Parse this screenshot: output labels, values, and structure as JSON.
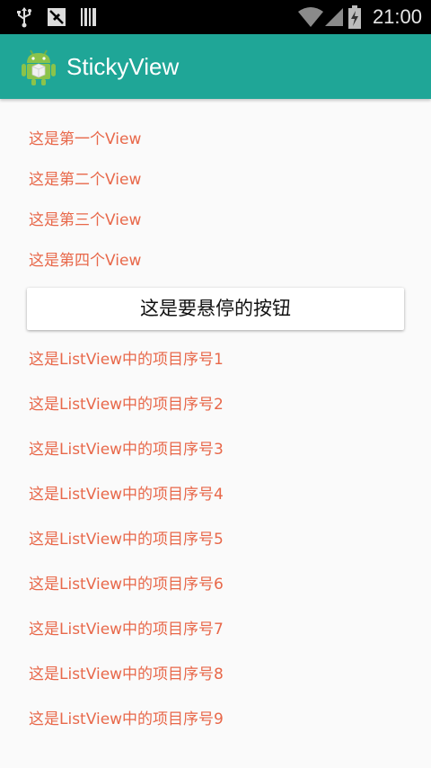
{
  "status_bar": {
    "time": "21:00",
    "icons": [
      "usb-icon",
      "no-sim-icon",
      "barcode-icon",
      "wifi-icon",
      "signal-icon",
      "battery-charging-icon"
    ]
  },
  "app_bar": {
    "title": "StickyView",
    "logo": "android-icon"
  },
  "top_items": [
    "这是第一个View",
    "这是第二个View",
    "这是第三个View",
    "这是第四个View"
  ],
  "sticky_button_label": "这是要悬停的按钮",
  "list_items": [
    "这是ListView中的项目序号1",
    "这是ListView中的项目序号2",
    "这是ListView中的项目序号3",
    "这是ListView中的项目序号4",
    "这是ListView中的项目序号5",
    "这是ListView中的项目序号6",
    "这是ListView中的项目序号7",
    "这是ListView中的项目序号8",
    "这是ListView中的项目序号9"
  ],
  "colors": {
    "app_bar": "#1fa697",
    "item_text": "#e8684a",
    "background": "#fafafa"
  }
}
